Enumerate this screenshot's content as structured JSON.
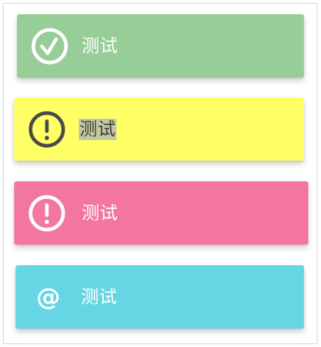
{
  "alerts": [
    {
      "text": "测试",
      "icon": "check-circle-icon",
      "background": "#97cd97",
      "icon_color": "#ffffff",
      "text_color": "#ffffff"
    },
    {
      "text": "测试",
      "icon": "exclamation-circle-icon",
      "background": "#ffff66",
      "icon_color": "#4a4a4a",
      "text_color": "#3f3f3f",
      "selected_text_highlight": "#c4c8a0"
    },
    {
      "text": "测试",
      "icon": "exclamation-circle-icon",
      "background": "#f2769e",
      "icon_color": "#ffffff",
      "text_color": "#ffffff"
    },
    {
      "text": "测试",
      "icon": "at-sign-icon",
      "background": "#66d5e4",
      "icon_color": "#ffffff",
      "text_color": "#ffffff"
    }
  ]
}
